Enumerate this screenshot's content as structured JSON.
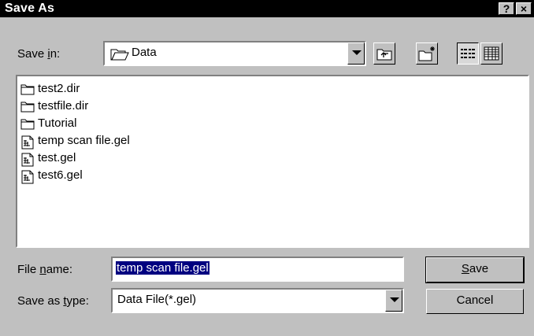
{
  "window": {
    "title": "Save As",
    "help_label": "?",
    "close_label": "×"
  },
  "save_in": {
    "label_pre": "Save ",
    "label_key": "i",
    "label_post": "n:",
    "value": "Data"
  },
  "toolbar": {
    "up_one_level": "up-folder-icon",
    "create_new_folder": "new-folder-icon",
    "list_view": "list-view-icon",
    "details_view": "details-view-icon"
  },
  "files": [
    {
      "name": "test2.dir",
      "icon": "folder-icon"
    },
    {
      "name": "testfile.dir",
      "icon": "folder-icon"
    },
    {
      "name": "Tutorial",
      "icon": "folder-icon"
    },
    {
      "name": "temp scan file.gel",
      "icon": "gel-file-icon"
    },
    {
      "name": "test.gel",
      "icon": "gel-file-icon"
    },
    {
      "name": "test6.gel",
      "icon": "gel-file-icon"
    }
  ],
  "file_name": {
    "label_pre": "File ",
    "label_key": "n",
    "label_post": "ame:",
    "value": "temp scan file.gel"
  },
  "save_as_type": {
    "label_pre": "Save as ",
    "label_key": "t",
    "label_post": "ype:",
    "value": "Data File(*.gel)"
  },
  "buttons": {
    "save_key": "S",
    "save_rest": "ave",
    "cancel": "Cancel"
  },
  "colors": {
    "titlebar": "#000000",
    "face": "#c0c0c0",
    "selection": "#000080"
  }
}
